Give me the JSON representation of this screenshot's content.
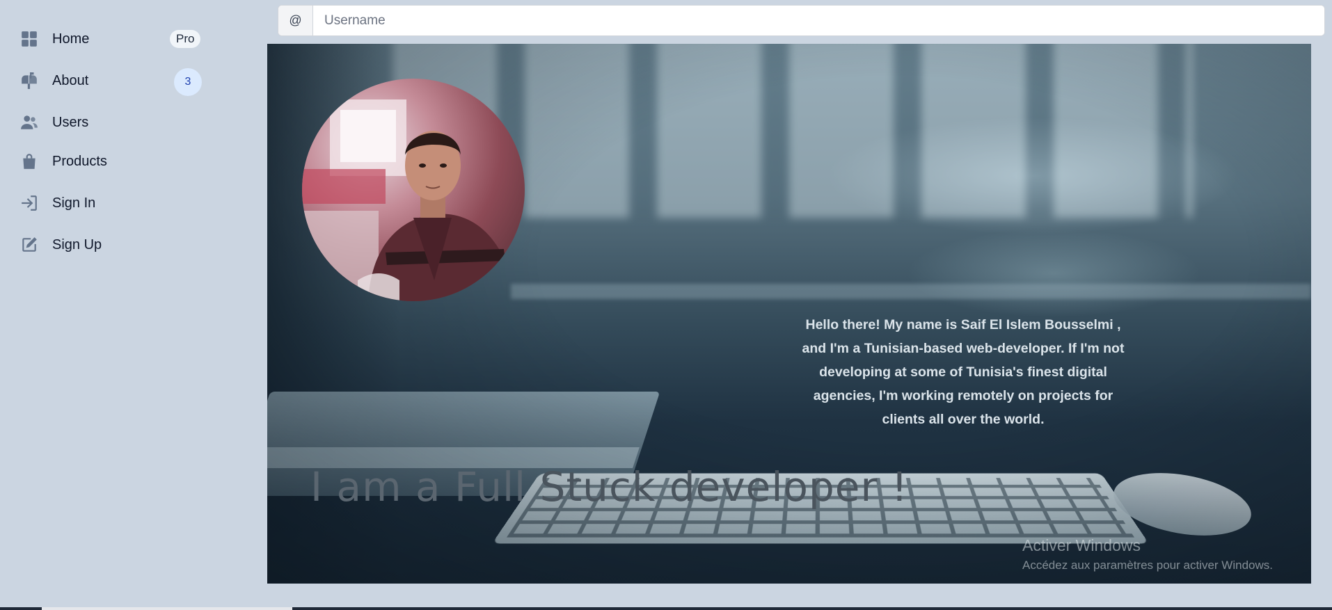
{
  "sidebar": {
    "items": [
      {
        "label": "Home",
        "icon": "grid-icon",
        "badge": "Pro"
      },
      {
        "label": "About",
        "icon": "mailbox-icon",
        "badge": "3"
      },
      {
        "label": "Users",
        "icon": "users-icon"
      },
      {
        "label": "Products",
        "icon": "shopping-bag-icon"
      },
      {
        "label": "Sign In",
        "icon": "sign-in-icon"
      },
      {
        "label": "Sign Up",
        "icon": "edit-icon"
      }
    ]
  },
  "search": {
    "addon": "@",
    "placeholder": "Username",
    "value": ""
  },
  "hero": {
    "bio": "Hello there! My name is Saif El Islem Bousselmi , and I'm a Tunisian-based web-developer. If I'm not developing at some of Tunisia's finest digital agencies, I'm working remotely on projects for clients all over the world.",
    "tagline_start": "I am a Full ",
    "tagline_end": "Stuck developer !"
  },
  "watermark": {
    "title": "Activer Windows",
    "subtitle": "Accédez aux paramètres pour activer Windows."
  },
  "colors": {
    "background": "#cbd5e1",
    "icon": "#64748b",
    "count_badge_bg": "#dbeafe",
    "count_badge_text": "#1e40af"
  }
}
